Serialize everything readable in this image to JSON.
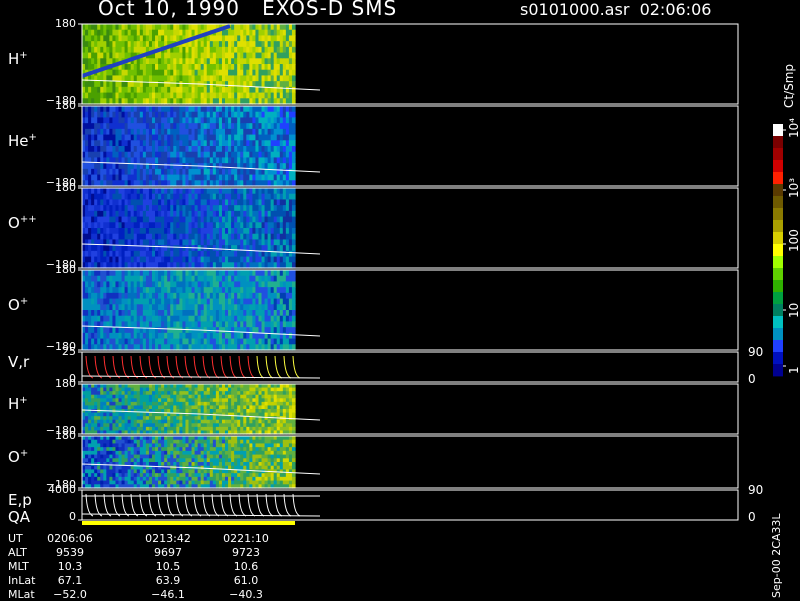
{
  "header": {
    "title": "Oct 10, 1990   EXOS-D SMS",
    "file": "s0101000.asr  02:06:06"
  },
  "panels": [
    {
      "id": "h1",
      "label": "H",
      "sup": "+",
      "top_tick": "180",
      "bottom_tick": "−180"
    },
    {
      "id": "he",
      "label": "He",
      "sup": "+",
      "top_tick": "180",
      "bottom_tick": "−180"
    },
    {
      "id": "opp",
      "label": "O",
      "sup": "++",
      "top_tick": "180",
      "bottom_tick": "−180"
    },
    {
      "id": "o1",
      "label": "O",
      "sup": "+",
      "top_tick": "180",
      "bottom_tick": "−180"
    },
    {
      "id": "vr",
      "label": "V,r",
      "sup": "",
      "top_tick": "25",
      "bottom_tick": "0",
      "right_top": "90",
      "right_bottom": "0"
    },
    {
      "id": "h2",
      "label": "H",
      "sup": "+",
      "top_tick": "180",
      "bottom_tick": "−180"
    },
    {
      "id": "o2",
      "label": "O",
      "sup": "+",
      "top_tick": "180",
      "bottom_tick": "−180"
    },
    {
      "id": "ep",
      "label": "E,p",
      "sup": "",
      "top_tick": "4000",
      "bottom_tick": "0",
      "right_top": "90",
      "right_bottom": "0"
    }
  ],
  "qa_label": "QA",
  "colorbar": {
    "unit": "Ct/Smp",
    "ticks": [
      "1",
      "10",
      "100",
      "10³",
      "10⁴"
    ],
    "colors": [
      "#ffffff",
      "#7a0000",
      "#a00000",
      "#d00000",
      "#ff2000",
      "#5a3a00",
      "#6e5a00",
      "#8a7a00",
      "#aaa000",
      "#d8d000",
      "#ffff00",
      "#a0ff00",
      "#60d000",
      "#30b000",
      "#00a040",
      "#008060",
      "#00c0c0",
      "#0090c0",
      "#2040ff",
      "#0010c0",
      "#000090"
    ]
  },
  "footer": {
    "keys": [
      "UT",
      "ALT",
      "MLT",
      "InLat",
      "MLat"
    ],
    "columns": [
      {
        "UT": "0206:06",
        "ALT": "9539",
        "MLT": "10.3",
        "InLat": "67.1",
        "MLat": "−52.0"
      },
      {
        "UT": "0213:42",
        "ALT": "9697",
        "MLT": "10.5",
        "InLat": "63.9",
        "MLat": "−46.1"
      },
      {
        "UT": "0221:10",
        "ALT": "9723",
        "MLT": "10.6",
        "InLat": "61.0",
        "MLat": "−40.3"
      }
    ],
    "side_text": "Sep-00 2CA33L"
  },
  "chart_data": {
    "type": "heatmap",
    "title": "Oct 10, 1990   EXOS-D SMS",
    "panels": [
      "H+",
      "He+",
      "O++",
      "O+",
      "V,r",
      "H+",
      "O+",
      "E,p"
    ],
    "colorbar_label": "Ct/Smp",
    "colorbar_ticks": [
      "1",
      "10",
      "100",
      "10³",
      "10⁴"
    ],
    "x_ticks": [
      "0206:06",
      "0213:42",
      "0221:10"
    ]
  }
}
